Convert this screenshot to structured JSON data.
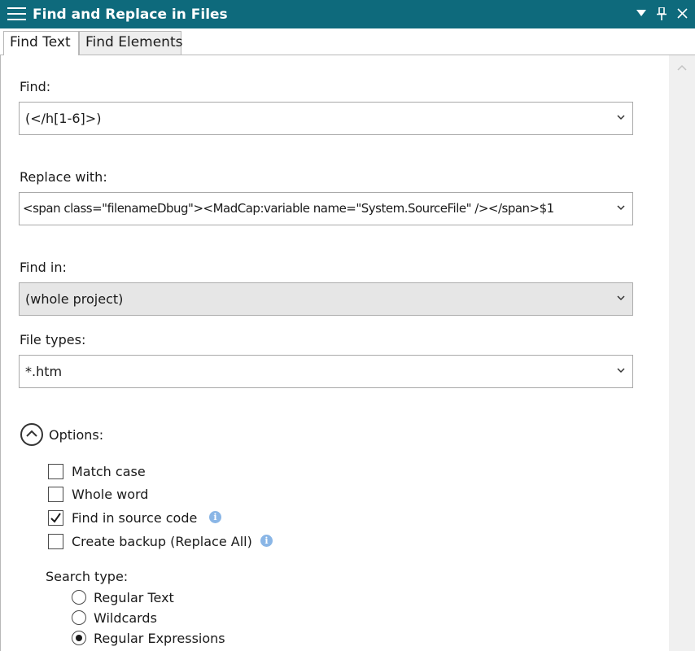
{
  "window": {
    "title": "Find and Replace in Files"
  },
  "tabs": [
    {
      "label": "Find Text",
      "active": true
    },
    {
      "label": "Find Elements",
      "active": false
    }
  ],
  "find": {
    "label": "Find:",
    "value": "(</h[1-6]>)"
  },
  "replace": {
    "label": "Replace with:",
    "value": "<span class=\"filenameDbug\"><MadCap:variable name=\"System.SourceFile\" /></span>$1"
  },
  "find_in": {
    "label": "Find in:",
    "value": "(whole project)"
  },
  "file_types": {
    "label": "File types:",
    "value": "*.htm"
  },
  "options": {
    "label": "Options:",
    "items": [
      {
        "label": "Match case",
        "checked": false
      },
      {
        "label": "Whole word",
        "checked": false
      },
      {
        "label": "Find in source code",
        "checked": true,
        "info": true
      },
      {
        "label": "Create backup (Replace All)",
        "checked": false,
        "info": true
      }
    ]
  },
  "search_type": {
    "label": "Search type:",
    "items": [
      {
        "label": "Regular Text",
        "selected": false
      },
      {
        "label": "Wildcards",
        "selected": false
      },
      {
        "label": "Regular Expressions",
        "selected": true
      }
    ]
  },
  "colors": {
    "titlebar": "#0e6a7c",
    "info_icon": "#8ab6e6"
  }
}
